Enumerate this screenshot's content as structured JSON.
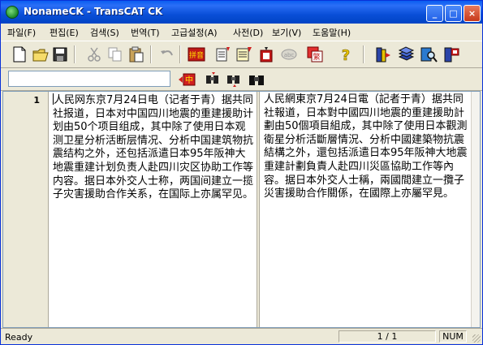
{
  "window": {
    "title": "NonameCK - TransCAT CK"
  },
  "title_buttons": {
    "minimize": "_",
    "maximize": "□",
    "close": "×"
  },
  "menu": [
    {
      "label": "파일(F)"
    },
    {
      "label": "편집(E)"
    },
    {
      "label": "검색(S)"
    },
    {
      "label": "번역(T)"
    },
    {
      "label": "고급설정(A)"
    },
    {
      "label": "사전(D)"
    },
    {
      "label": "보기(V)"
    },
    {
      "label": "도움말(H)"
    }
  ],
  "toolbar": {
    "icons": [
      "new-file-icon",
      "open-folder-icon",
      "save-icon",
      "cut-icon",
      "copy-icon",
      "paste-icon",
      "undo-icon",
      "hanja-convert-icon",
      "translate-down-icon",
      "translate-all-icon",
      "translate-block-icon",
      "dictionary-disabled-icon",
      "convert-simplified-traditional-icon",
      "help-icon",
      "book-arrow-icon",
      "books-icon",
      "search-book-icon",
      "flag-book-icon"
    ],
    "hanja_label": "拼音",
    "help_label": "?"
  },
  "search": {
    "value": "",
    "find_labels": [
      "中"
    ]
  },
  "editor": {
    "line_number": "1",
    "source_text": "人民网东京7月24日电（记者于青）据共同社报道，日本对中国四川地震的重建援助计划由50个项目组成，其中除了使用日本观测卫星分析活断层情况、分析中国建筑物抗震结构之外，还包括派遣日本95年阪神大地震重建计划负责人赴四川灾区协助工作等内容。据日本外交人士称，两国间建立一揽子灾害援助合作关系，在国际上亦属罕见。",
    "target_text": "人民網東京7月24日電（記者于青）据共同社報道，日本對中國四川地震的重建援助計劃由50個項目組成，其中除了使用日本觀測衛星分析活斷層情況、分析中國建築物抗震結構之外，還包括派遣日本95年阪神大地震重建計劃負責人赴四川災區協助工作等內容。据日本外交人士稱，兩國間建立一攬子災害援助合作關係，在國際上亦屬罕見。"
  },
  "status": {
    "ready": "Ready",
    "page": "1 / 1",
    "num": "NUM"
  },
  "colors": {
    "highlight": "#e02020",
    "title_bar": "#0a4fd8"
  }
}
